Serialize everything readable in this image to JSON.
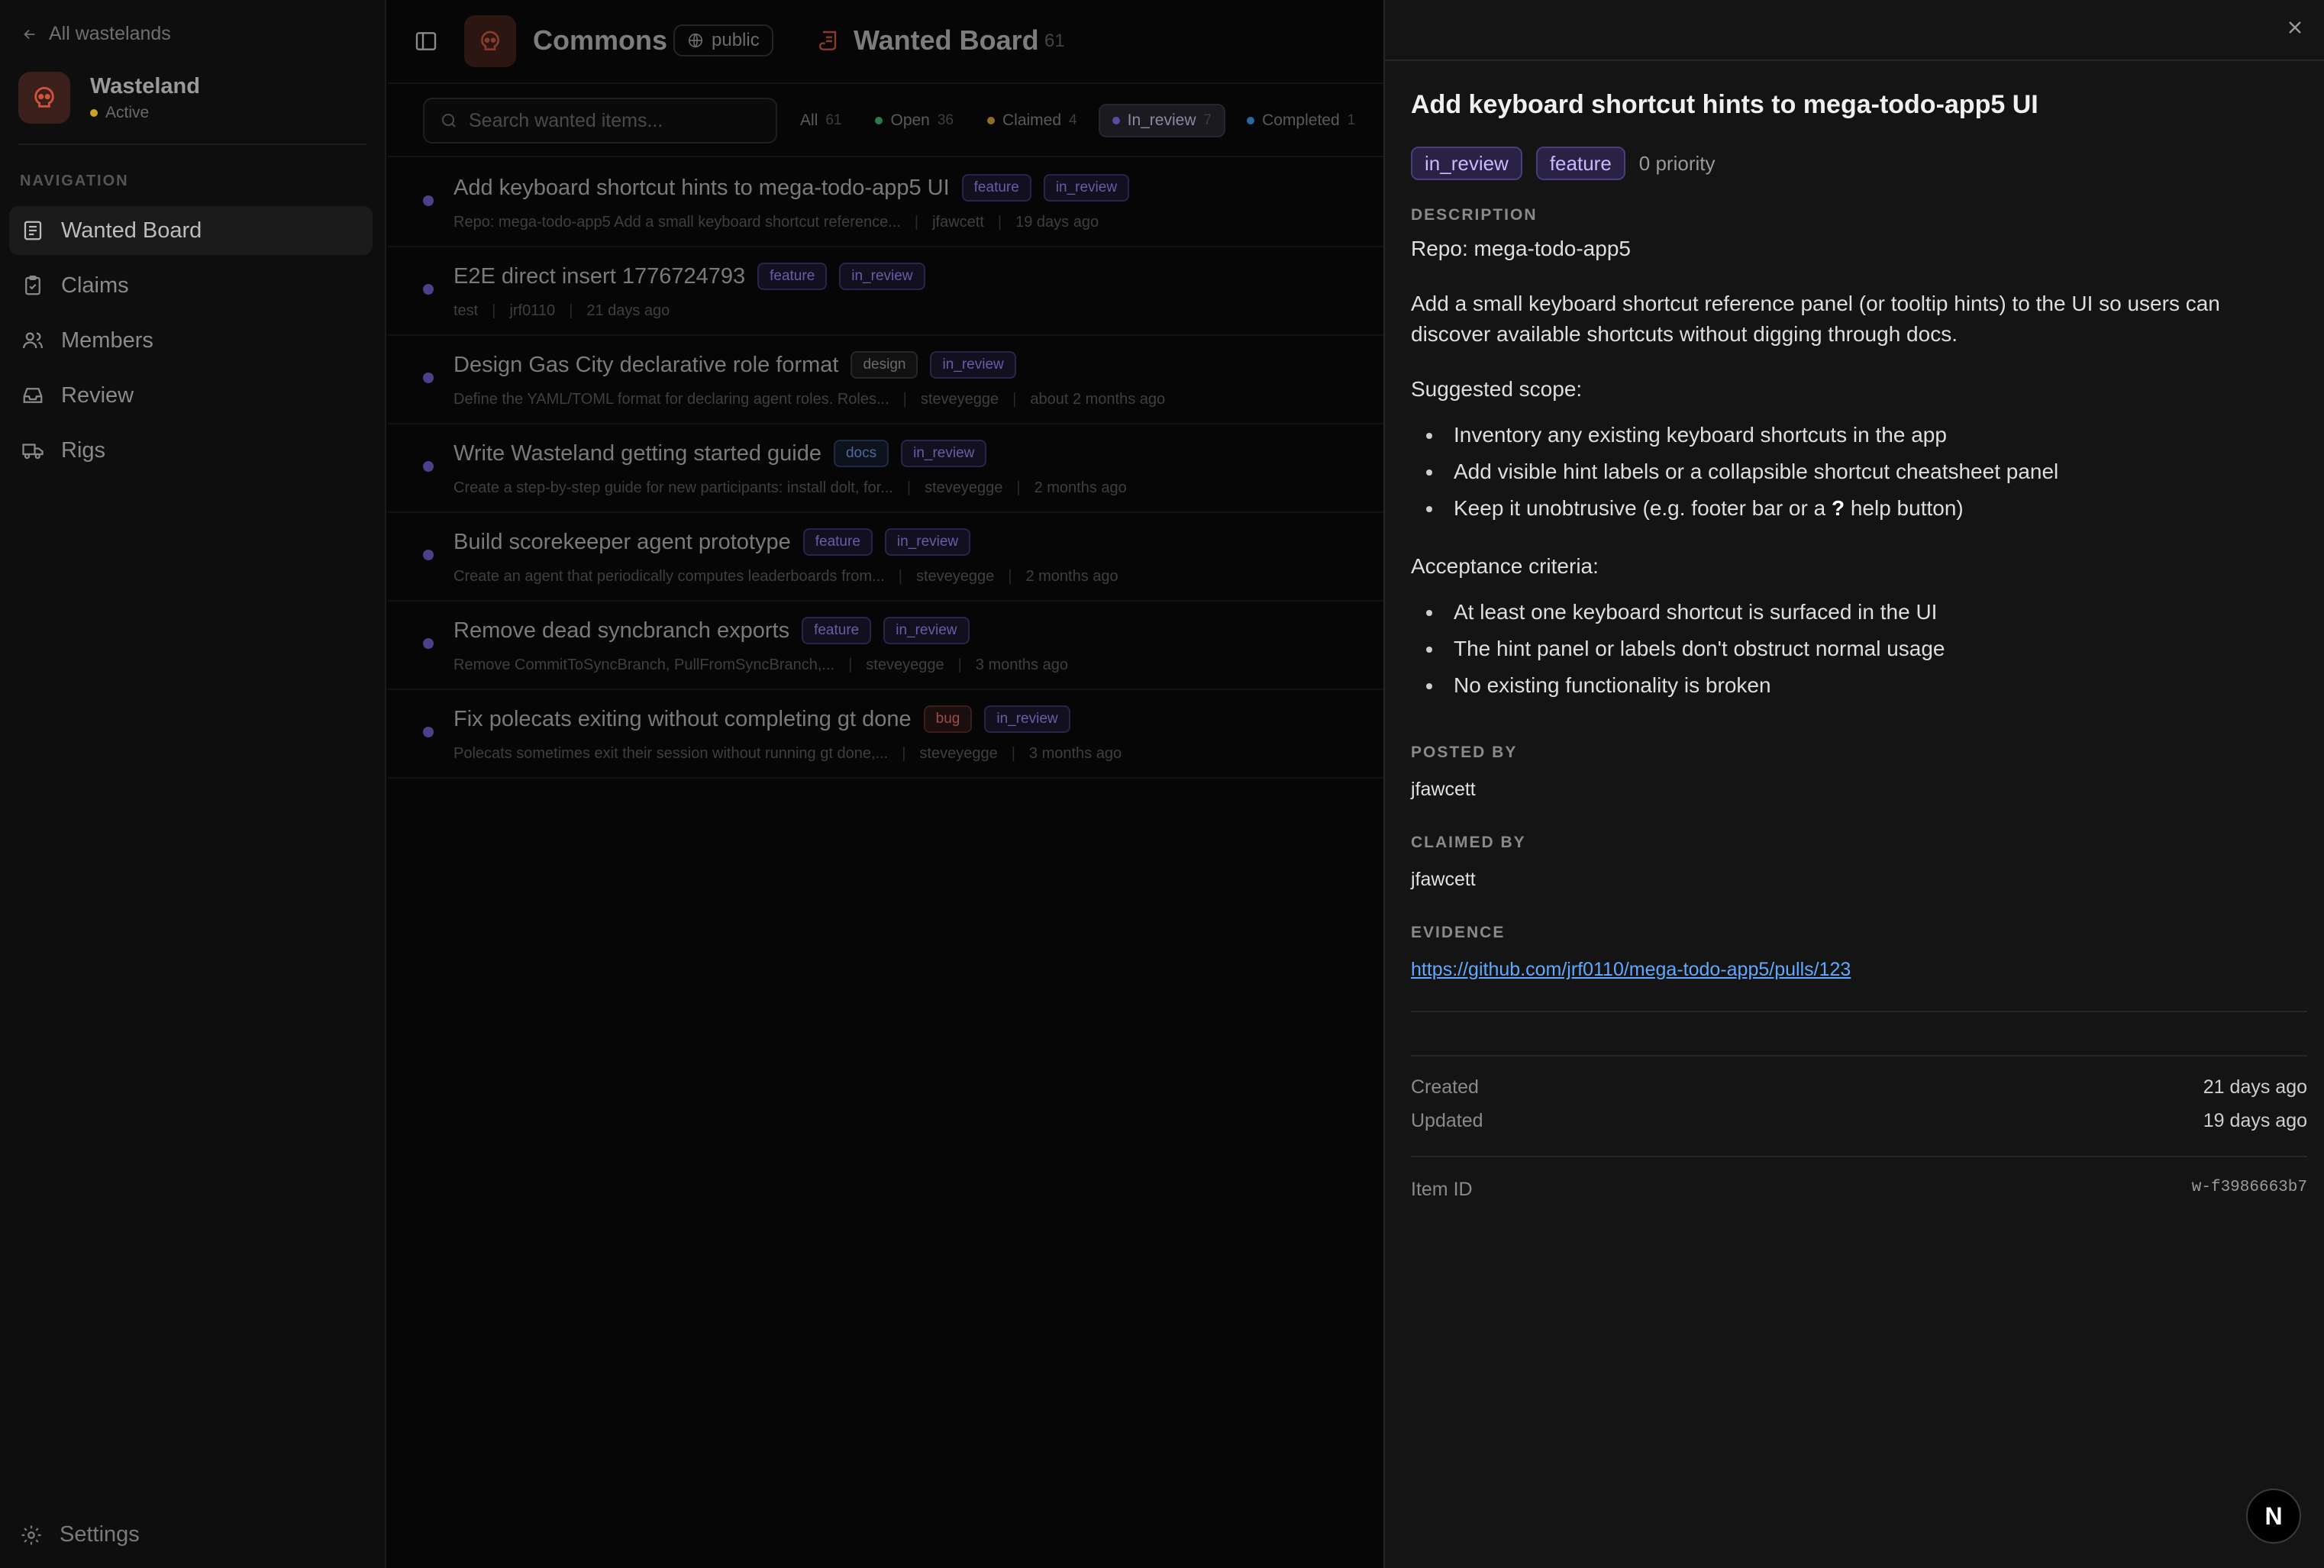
{
  "sidebar": {
    "back_label": "All wastelands",
    "org": {
      "name": "Wasteland",
      "status": "Active",
      "status_color": "#c9a227"
    },
    "nav_heading": "NAVIGATION",
    "items": [
      {
        "label": "Wanted Board",
        "icon": "board-icon",
        "active": true
      },
      {
        "label": "Claims",
        "icon": "clipboard-icon",
        "active": false
      },
      {
        "label": "Members",
        "icon": "users-icon",
        "active": false
      },
      {
        "label": "Review",
        "icon": "inbox-icon",
        "active": false
      },
      {
        "label": "Rigs",
        "icon": "truck-icon",
        "active": false
      }
    ],
    "settings_label": "Settings"
  },
  "topbar": {
    "title": "Commons",
    "visibility": "public",
    "board_title": "Wanted Board",
    "board_count": "61"
  },
  "filters": {
    "search_placeholder": "Search wanted items...",
    "chips": [
      {
        "label": "All",
        "count": "61",
        "dot": null,
        "active": false
      },
      {
        "label": "Open",
        "count": "36",
        "dot": "#3aa864",
        "active": false
      },
      {
        "label": "Claimed",
        "count": "4",
        "dot": "#c9a227",
        "active": false
      },
      {
        "label": "In_review",
        "count": "7",
        "dot": "#7a62d6",
        "active": true
      },
      {
        "label": "Completed",
        "count": "1",
        "dot": "#3a8ad6",
        "active": false
      }
    ]
  },
  "items": [
    {
      "title": "Add keyboard shortcut hints to mega-todo-app5 UI",
      "tags": [
        "feature",
        "in_review"
      ],
      "desc": "Repo: mega-todo-app5 Add a small keyboard shortcut reference...",
      "author": "jfawcett",
      "age": "19 days ago"
    },
    {
      "title": "E2E direct insert 1776724793",
      "tags": [
        "feature",
        "in_review"
      ],
      "desc": "test",
      "author": "jrf0110",
      "age": "21 days ago"
    },
    {
      "title": "Design Gas City declarative role format",
      "tags": [
        "design",
        "in_review"
      ],
      "desc": "Define the YAML/TOML format for declaring agent roles. Roles...",
      "author": "steveyegge",
      "age": "about 2 months ago"
    },
    {
      "title": "Write Wasteland getting started guide",
      "tags": [
        "docs",
        "in_review"
      ],
      "desc": "Create a step-by-step guide for new participants: install dolt, for...",
      "author": "steveyegge",
      "age": "2 months ago"
    },
    {
      "title": "Build scorekeeper agent prototype",
      "tags": [
        "feature",
        "in_review"
      ],
      "desc": "Create an agent that periodically computes leaderboards from...",
      "author": "steveyegge",
      "age": "2 months ago"
    },
    {
      "title": "Remove dead syncbranch exports",
      "tags": [
        "feature",
        "in_review"
      ],
      "desc": "Remove CommitToSyncBranch, PullFromSyncBranch,...",
      "author": "steveyegge",
      "age": "3 months ago"
    },
    {
      "title": "Fix polecats exiting without completing gt done",
      "tags": [
        "bug",
        "in_review"
      ],
      "desc": "Polecats sometimes exit their session without running gt done,...",
      "author": "steveyegge",
      "age": "3 months ago"
    }
  ],
  "detail": {
    "title": "Add keyboard shortcut hints to mega-todo-app5 UI",
    "status_tag": "in_review",
    "type_tag": "feature",
    "priority": "0 priority",
    "description_label": "DESCRIPTION",
    "description": {
      "repo_line": "Repo: mega-todo-app5",
      "intro": "Add a small keyboard shortcut reference panel (or tooltip hints) to the UI so users can discover available shortcuts without digging through docs.",
      "scope_heading": "Suggested scope:",
      "scope": [
        "Inventory any existing keyboard shortcuts in the app",
        "Add visible hint labels or a collapsible shortcut cheatsheet panel"
      ],
      "scope_last_prefix": "Keep it unobtrusive (e.g. footer bar or a ",
      "scope_last_key": "?",
      "scope_last_suffix": " help button)",
      "criteria_heading": "Acceptance criteria:",
      "criteria": [
        "At least one keyboard shortcut is surfaced in the UI",
        "The hint panel or labels don't obstruct normal usage",
        "No existing functionality is broken"
      ]
    },
    "posted_by_label": "POSTED BY",
    "posted_by": "jfawcett",
    "claimed_by_label": "CLAIMED BY",
    "claimed_by": "jfawcett",
    "evidence_label": "EVIDENCE",
    "evidence_url": "https://github.com/jrf0110/mega-todo-app5/pulls/123",
    "created_label": "Created",
    "created": "21 days ago",
    "updated_label": "Updated",
    "updated": "19 days ago",
    "item_id_label": "Item ID",
    "item_id": "w-f3986663b7"
  },
  "badge_letter": "N",
  "colors": {
    "accent": "#7a62d6",
    "link": "#62a8ff",
    "brand": "#d0553a"
  }
}
